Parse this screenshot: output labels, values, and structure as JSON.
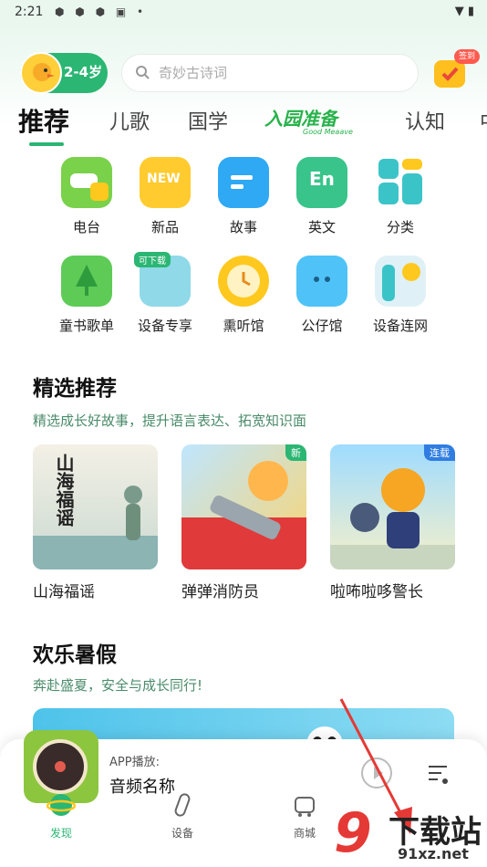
{
  "status_bar": {
    "time": "2:21",
    "battery_text": "▮"
  },
  "header": {
    "age_label": "2-4岁",
    "search_placeholder": "奇妙古诗词",
    "checkin_tag": "签到"
  },
  "tabs": {
    "items": [
      "推荐",
      "儿歌",
      "国学",
      "认知",
      "中"
    ],
    "banner_tab": "入园准备",
    "banner_sub": "Good Meaave"
  },
  "grid": {
    "row1": [
      "电台",
      "新品",
      "故事",
      "英文",
      "分类"
    ],
    "row2": [
      "童书歌单",
      "设备专享",
      "熏听馆",
      "公仔馆",
      "设备连网"
    ],
    "new_tag": "NEW",
    "en_tag": "En",
    "download_tag": "可下载"
  },
  "featured": {
    "title": "精选推荐",
    "subtitle": "精选成长好故事，提升语言表达、拓宽知识面",
    "cards": [
      {
        "title": "山海福谣",
        "cover_text": "山海福谣",
        "badge": ""
      },
      {
        "title": "弹弹消防员",
        "badge": "新"
      },
      {
        "title": "啦咘啦哆警长",
        "badge": "连载"
      }
    ]
  },
  "summer": {
    "title": "欢乐暑假",
    "subtitle": "奔赴盛夏，安全与成长同行!"
  },
  "player": {
    "source": "APP播放:",
    "track": "音频名称"
  },
  "nav": {
    "items": [
      "发现",
      "设备",
      "商城"
    ]
  },
  "watermark": {
    "text": "下载站",
    "url": "91xz.net",
    "logo": "9"
  }
}
